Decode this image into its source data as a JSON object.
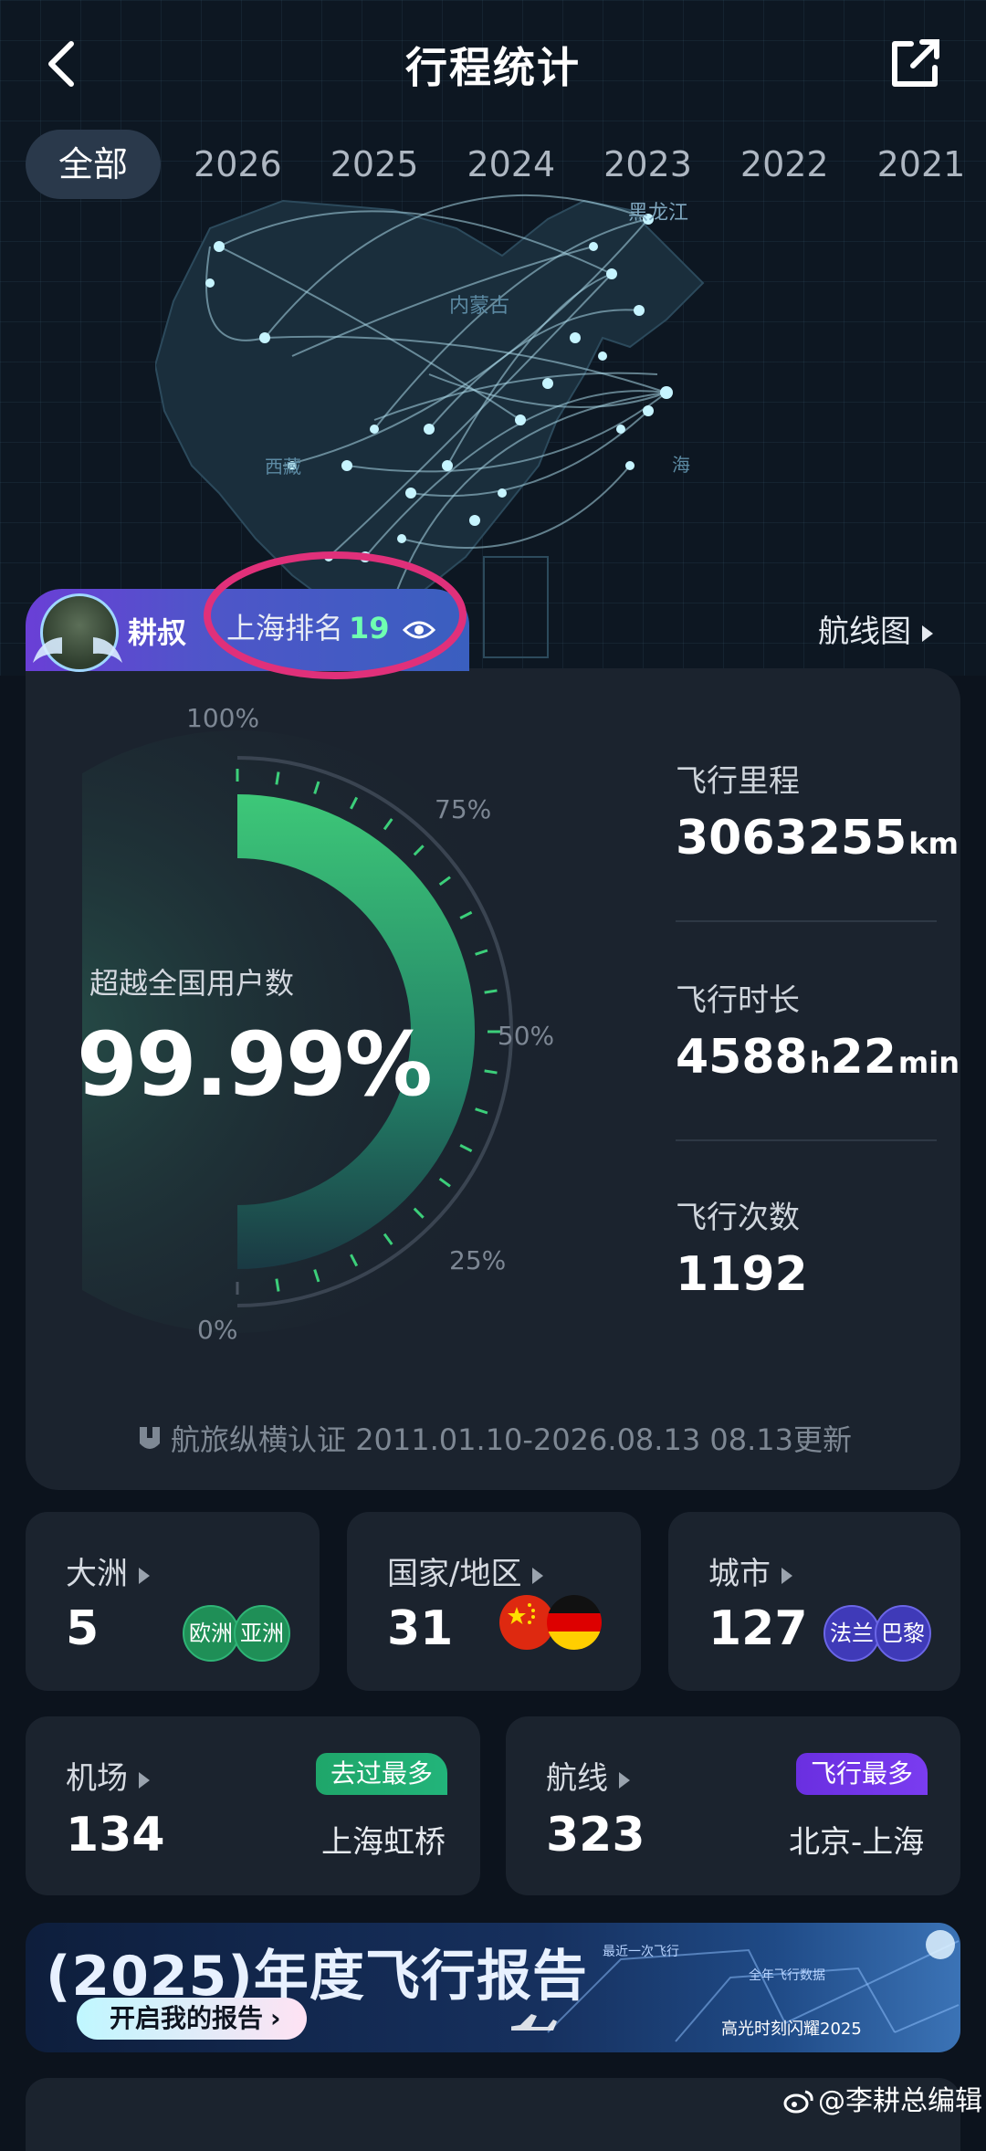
{
  "header": {
    "title": "行程统计"
  },
  "tabs": [
    "全部",
    "2026",
    "2025",
    "2024",
    "2023",
    "2022",
    "2021"
  ],
  "map": {
    "labels": [
      "黑龙江",
      "内蒙古",
      "海",
      "西藏"
    ],
    "route_link": "航线图"
  },
  "user": {
    "name": "耕叔",
    "rank_label": "上海排名",
    "rank_value": "19"
  },
  "gauge": {
    "ticks": [
      "100%",
      "75%",
      "50%",
      "25%",
      "0%"
    ],
    "value_fraction": 0.9999,
    "surpass_label": "超越全国用户数",
    "surpass_value": "99.99%"
  },
  "metrics": {
    "distance": {
      "label": "飞行里程",
      "value": "3063255",
      "unit": "km"
    },
    "duration": {
      "label": "飞行时长",
      "hours": "4588",
      "h_unit": "h",
      "minutes": "22",
      "min_unit": "min"
    },
    "count": {
      "label": "飞行次数",
      "value": "1192"
    }
  },
  "certification": "航旅纵横认证 2011.01.10-2026.08.13 08.13更新",
  "tiles": {
    "continents": {
      "label": "大洲",
      "value": "5",
      "chips": [
        "欧洲",
        "亚洲"
      ]
    },
    "countries": {
      "label": "国家/地区",
      "value": "31"
    },
    "cities": {
      "label": "城市",
      "value": "127",
      "chips": [
        "法兰",
        "巴黎"
      ]
    },
    "airports": {
      "label": "机场",
      "value": "134",
      "tag": "去过最多",
      "sub": "上海虹桥"
    },
    "routes": {
      "label": "航线",
      "value": "323",
      "tag": "飞行最多",
      "sub": "北京-上海"
    }
  },
  "banner": {
    "title": "(2025)年度飞行报告",
    "button": "开启我的报告",
    "deco_lines": [
      "最近一次飞行",
      "全年飞行数据",
      "高光时刻闪耀2025"
    ]
  },
  "watermark": "@李耕总编辑",
  "colors": {
    "accent_green": "#3ccf7a",
    "rank_green": "#6fffb1",
    "tag_green": "#22b47a",
    "tag_purple": "#7a3cf0",
    "highlight_pink": "#e0307a"
  }
}
